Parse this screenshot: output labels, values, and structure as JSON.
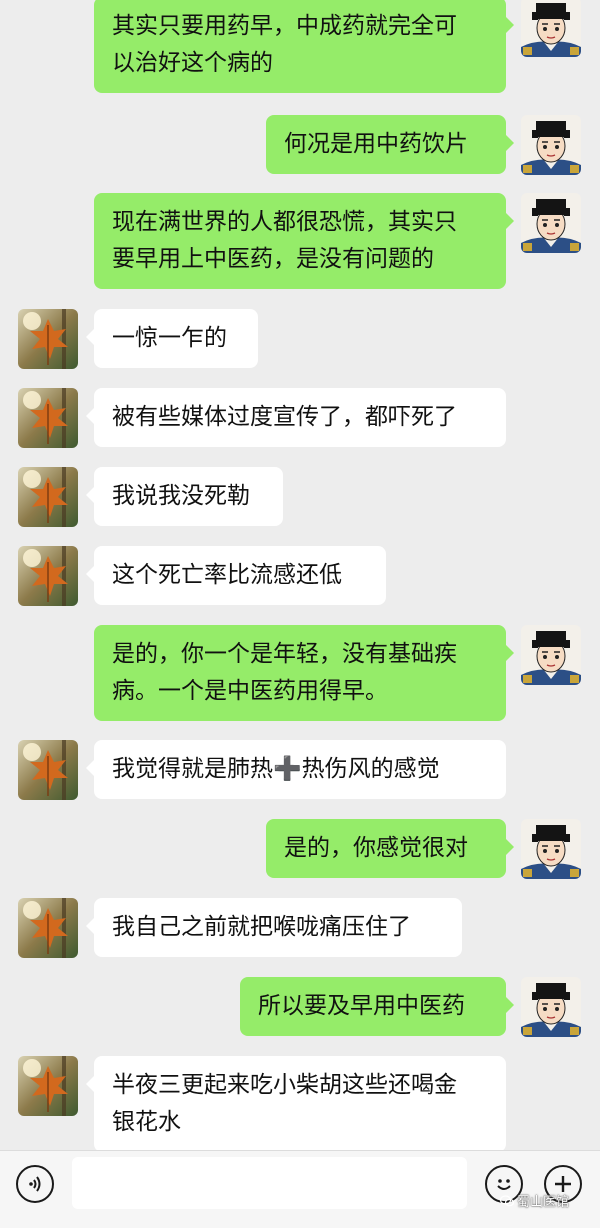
{
  "messages": [
    {
      "side": "right",
      "lines": [
        "其实只要用药早，中成药就完全可",
        "以治好这个病的"
      ]
    },
    {
      "side": "right",
      "lines": [
        "何况是用中药饮片"
      ]
    },
    {
      "side": "right",
      "lines": [
        "现在满世界的人都很恐慌，其实只",
        "要早用上中医药，是没有问题的"
      ]
    },
    {
      "side": "left",
      "lines": [
        "一惊一乍的"
      ]
    },
    {
      "side": "left",
      "lines": [
        "被有些媒体过度宣传了，都吓死了"
      ]
    },
    {
      "side": "left",
      "lines": [
        "我说我没死勒"
      ]
    },
    {
      "side": "left",
      "lines": [
        "这个死亡率比流感还低"
      ]
    },
    {
      "side": "right",
      "lines": [
        "是的，你一个是年轻，没有基础疾",
        "病。一个是中医药用得早。"
      ]
    },
    {
      "side": "left",
      "lines": [
        "我觉得就是肺热",
        "➕",
        "热伤风的感觉"
      ]
    },
    {
      "side": "right",
      "lines": [
        "是的，你感觉很对"
      ]
    },
    {
      "side": "left",
      "lines": [
        "我自己之前就把喉咙痛压住了"
      ]
    },
    {
      "side": "right",
      "lines": [
        "所以要及早用中医药"
      ]
    },
    {
      "side": "left",
      "lines": [
        "半夜三更起来吃小柴胡这些还喝金",
        "银花水"
      ]
    }
  ],
  "input": {
    "placeholder": "",
    "value": ""
  },
  "watermark": "蜀山医馆",
  "colors": {
    "background": "#ededed",
    "sent_bubble": "#95ec69",
    "received_bubble": "#ffffff"
  },
  "icons": [
    "voice-icon",
    "emoji-icon",
    "plus-icon"
  ]
}
